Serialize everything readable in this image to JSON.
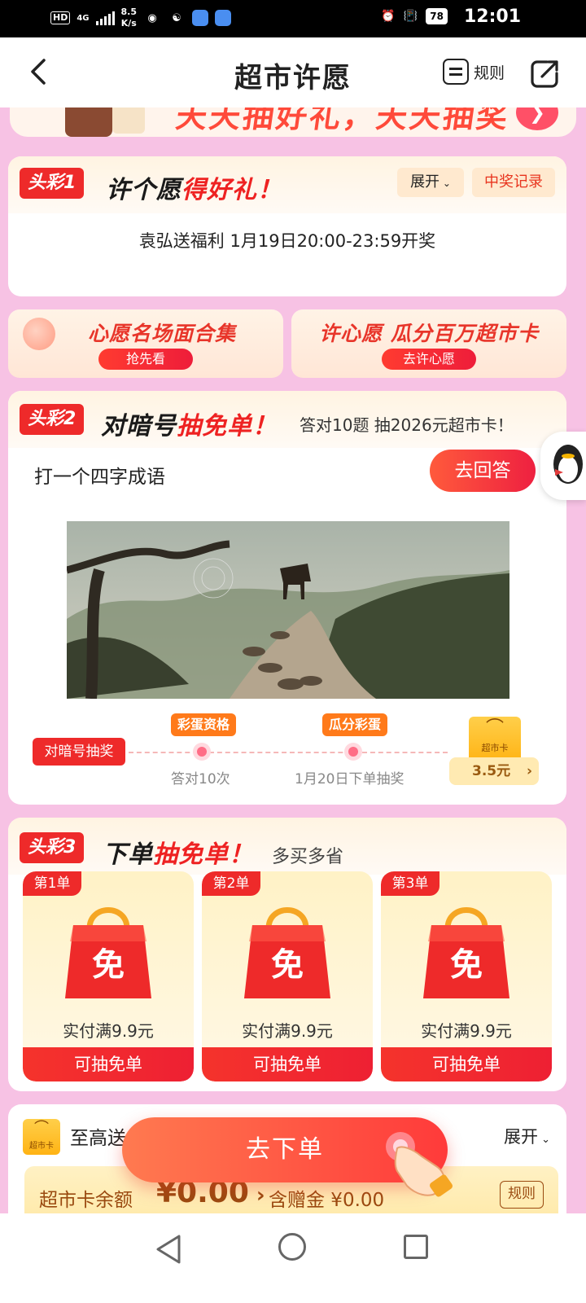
{
  "status_bar": {
    "hd": "HD",
    "network": "4G",
    "speed_value": "8.5",
    "speed_unit": "K/s",
    "battery": "78",
    "time": "12:01"
  },
  "nav": {
    "title": "超市许愿",
    "rules": "规则"
  },
  "top_banner": {
    "text": "天天抽好礼，天天抽奖"
  },
  "section1": {
    "tag": "头彩1",
    "title_a": "许个愿",
    "title_b": "得好礼！",
    "expand": "展开",
    "record": "中奖记录",
    "info": "袁弘送福利   1月19日20:00-23:59开奖"
  },
  "mini_banners": [
    {
      "title": "心愿名场面合集",
      "button": "抢先看"
    },
    {
      "title": "许心愿 瓜分百万超市卡",
      "button": "去许心愿"
    }
  ],
  "section2": {
    "tag": "头彩2",
    "title_a": "对暗号",
    "title_b": "抽免单！",
    "subtitle": "答对10题 抽2026元超市卡！",
    "riddle": "打一个四字成语",
    "answer_button": "去回答",
    "step_start": "对暗号抽奖",
    "steps": [
      {
        "badge": "彩蛋资格",
        "label": "答对10次"
      },
      {
        "badge": "瓜分彩蛋",
        "label": "1月20日下单抽奖"
      }
    ],
    "card_icon_label": "超市卡",
    "card_price": "3.5元"
  },
  "section3": {
    "tag": "头彩3",
    "title_a": "下单",
    "title_b": "抽免单！",
    "subtitle": "多买多省",
    "prizes": [
      {
        "tag": "第1单",
        "bag_char": "免",
        "label": "实付满9.9元",
        "button": "可抽免单"
      },
      {
        "tag": "第2单",
        "bag_char": "免",
        "label": "实付满9.9元",
        "button": "可抽免单"
      },
      {
        "tag": "第3单",
        "bag_char": "免",
        "label": "实付满9.9元",
        "button": "可抽免单"
      }
    ]
  },
  "section4": {
    "logo_label": "超市卡",
    "title": "至高送",
    "expand": "展开",
    "balance_label": "超市卡余额",
    "balance_amount": "¥0.00",
    "gift_label": "含赠金 ¥0.00",
    "rule": "规则"
  },
  "order_button": "去下单",
  "colors": {
    "page_bg": "#f7c2e4",
    "accent_red": "#ee2a2a",
    "gold": "#ffb314"
  }
}
